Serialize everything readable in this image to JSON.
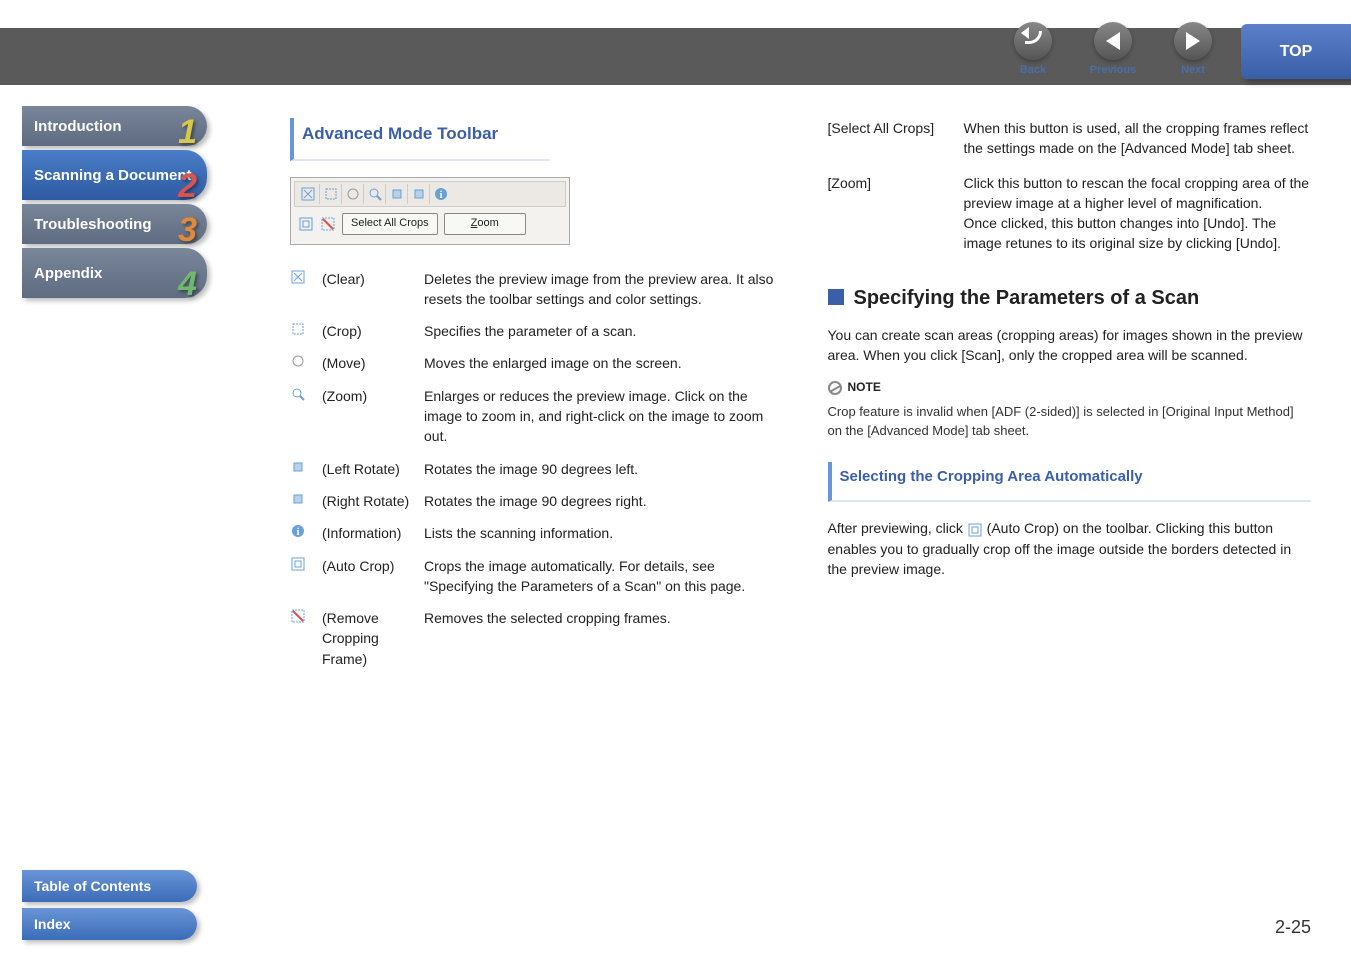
{
  "top": {
    "back": "Back",
    "previous": "Previous",
    "next": "Next",
    "top": "TOP"
  },
  "sidebar": {
    "intro": "Introduction",
    "intro_n": "1",
    "scan": "Scanning a Document",
    "scan_n": "2",
    "trouble": "Troubleshooting",
    "trouble_n": "3",
    "appendix": "Appendix",
    "appendix_n": "4",
    "toc": "Table of Contents",
    "index": "Index"
  },
  "page_num": "2-25",
  "left": {
    "heading": "Advanced Mode Toolbar",
    "btn_select_all": "Select All Crops",
    "btn_zoom": "Zoom",
    "rows": [
      {
        "lbl": "(Clear)",
        "txt": "Deletes the preview image from the preview area. It also resets the toolbar settings and color settings."
      },
      {
        "lbl": "(Crop)",
        "txt": "Specifies the parameter of a scan."
      },
      {
        "lbl": "(Move)",
        "txt": "Moves the enlarged image on the screen."
      },
      {
        "lbl": "(Zoom)",
        "txt": "Enlarges or reduces the preview image. Click on the image to zoom in, and right-click on the image to zoom out."
      },
      {
        "lbl": "(Left Rotate)",
        "txt": "Rotates the image 90 degrees left."
      },
      {
        "lbl": "(Right Rotate)",
        "txt": "Rotates the image 90 degrees right."
      },
      {
        "lbl": "(Information)",
        "txt": "Lists the scanning information."
      },
      {
        "lbl": "(Auto Crop)",
        "txt": "Crops the image automatically. For details, see \"Specifying the Parameters of a Scan\" on this page."
      },
      {
        "lbl": "(Remove Cropping Frame)",
        "txt": "Removes the selected cropping frames."
      }
    ]
  },
  "right": {
    "defs": [
      {
        "k": "[Select All Crops]",
        "v": "When this button is used, all the cropping frames reflect the settings made on the [Advanced Mode] tab sheet."
      },
      {
        "k": "[Zoom]",
        "v": "Click this button to rescan the focal cropping area of the preview image at a higher level of magnification.\nOnce clicked, this button changes into [Undo]. The image retunes to its original size by clicking [Undo]."
      }
    ],
    "h2": "Specifying the Parameters of a Scan",
    "p1": "You can create scan areas (cropping areas) for images shown in the preview area. When you click [Scan], only the cropped area will be scanned.",
    "note_lbl": "NOTE",
    "note_txt": "Crop feature is invalid when [ADF (2-sided)] is selected in [Original Input Method] on the [Advanced Mode] tab sheet.",
    "h3": "Selecting the Cropping Area Automatically",
    "p2a": "After previewing, click ",
    "p2b": " (Auto Crop) on the toolbar. Clicking this button enables you to gradually crop off the image outside the borders detected in the preview image."
  }
}
